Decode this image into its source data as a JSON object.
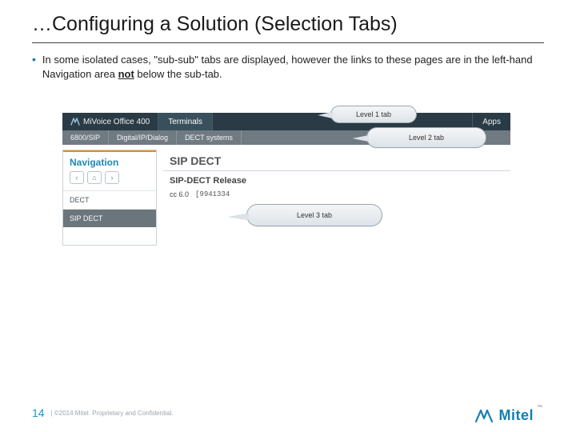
{
  "title": "…Configuring a Solution (Selection Tabs)",
  "bullet": {
    "pre": "In some isolated cases, \"sub-sub\" tabs are displayed, however the links to these pages are in the left-hand Navigation area ",
    "emph": "not",
    "post": " below the sub-tab."
  },
  "topnav": {
    "brand": "MiVoice Office 400",
    "items": [
      "Terminals",
      "Apps"
    ]
  },
  "subnav": {
    "items": [
      "6800/SIP",
      "Digital/IP/Dialog",
      "DECT systems"
    ]
  },
  "sidebar": {
    "heading": "Navigation",
    "icons": [
      "‹",
      "⌂",
      "›"
    ],
    "items": [
      "DECT",
      "SIP DECT"
    ]
  },
  "content": {
    "heading": "SIP DECT",
    "subheading": "SIP-DECT Release",
    "row_label": "cc 6.0",
    "row_value": "[9941334"
  },
  "callouts": {
    "level1": "Level 1 tab",
    "level2": "Level 2 tab",
    "level3": "Level 3 tab"
  },
  "footer": {
    "page": "14",
    "copyright": "| ©2014 Mitel. Proprietary and Confidential."
  },
  "logo": {
    "text": "Mitel",
    "tm": "™"
  }
}
